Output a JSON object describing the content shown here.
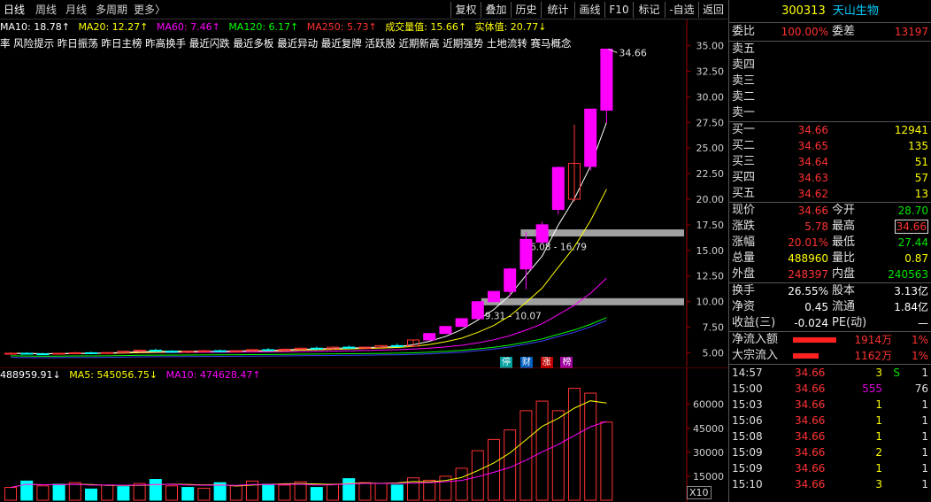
{
  "toolbar": {
    "tabs": [
      "日线",
      "周线",
      "月线",
      "多周期",
      "更多〉"
    ],
    "buttons": [
      "复权",
      "叠加",
      "历史",
      "统计",
      "画线",
      "F10",
      "标记",
      "-自选",
      "返回"
    ]
  },
  "ma": {
    "ma10": "MA10: 18.78↑",
    "ma20": "MA20: 12.27↑",
    "ma60": "MA60: 7.46↑",
    "ma120": "MA120: 6.17↑",
    "ma250": "MA250: 5.73↑",
    "vol": "成交量值: 15.66↑",
    "body": "实体值: 20.77↓"
  },
  "concepts": "率 风险提示 昨日振荡 昨日主榜 昨高换手 最近闪跌 最近多板 最近异动 最近复牌 活跃股 近期新高 近期强势 土地流转 赛马概念",
  "price_axis": [
    "35.00",
    "32.50",
    "30.00",
    "27.50",
    "25.00",
    "22.50",
    "20.00",
    "17.50",
    "15.00",
    "12.50",
    "10.00",
    "7.50",
    "5.00"
  ],
  "price_annotations": {
    "high_label": "34.66",
    "zone1": "16.08 - 16.79",
    "zone2": "9.31 - 10.07"
  },
  "badges": [
    "停",
    "财",
    "涨",
    "榜"
  ],
  "volume_line": {
    "vol": "488959.91↓",
    "ma5": "MA5: 545056.75↓",
    "ma10": "MA10: 474628.47↑"
  },
  "volume_axis": [
    "60000",
    "45000",
    "30000",
    "15000"
  ],
  "x10": "X10",
  "colors": {
    "up": "#ff3232",
    "down": "#00ffff",
    "limit_up": "#ff00ff",
    "ma10": "#ffffff",
    "ma20": "#ffff00",
    "ma60": "#ff00ff",
    "ma120": "#00ff00",
    "ma250": "#4040ff"
  },
  "stock": {
    "code": "300313",
    "name": "天山生物"
  },
  "order": {
    "webi_label": "委比",
    "webi": "100.00%",
    "wecha_label": "委差",
    "wecha": "13197",
    "sells": [
      {
        "label": "卖五",
        "price": "",
        "vol": ""
      },
      {
        "label": "卖四",
        "price": "",
        "vol": ""
      },
      {
        "label": "卖三",
        "price": "",
        "vol": ""
      },
      {
        "label": "卖二",
        "price": "",
        "vol": ""
      },
      {
        "label": "卖一",
        "price": "",
        "vol": ""
      }
    ],
    "buys": [
      {
        "label": "买一",
        "price": "34.66",
        "vol": "12941"
      },
      {
        "label": "买二",
        "price": "34.65",
        "vol": "135"
      },
      {
        "label": "买三",
        "price": "34.64",
        "vol": "51"
      },
      {
        "label": "买四",
        "price": "34.63",
        "vol": "57"
      },
      {
        "label": "买五",
        "price": "34.62",
        "vol": "13"
      }
    ]
  },
  "quote": [
    {
      "l1": "现价",
      "v1": "34.66",
      "c1": "red",
      "l2": "今开",
      "v2": "28.70",
      "c2": "green"
    },
    {
      "l1": "涨跌",
      "v1": "5.78",
      "c1": "red",
      "l2": "最高",
      "v2": "34.66",
      "c2": "red"
    },
    {
      "l1": "涨幅",
      "v1": "20.01%",
      "c1": "red",
      "l2": "最低",
      "v2": "27.44",
      "c2": "green"
    },
    {
      "l1": "总量",
      "v1": "488960",
      "c1": "yellow",
      "l2": "量比",
      "v2": "0.87",
      "c2": "yellow"
    },
    {
      "l1": "外盘",
      "v1": "248397",
      "c1": "red",
      "l2": "内盘",
      "v2": "240563",
      "c2": "green"
    }
  ],
  "fund": [
    {
      "l1": "换手",
      "v1": "26.55%",
      "l2": "股本",
      "v2": "3.13亿"
    },
    {
      "l1": "净资",
      "v1": "0.45",
      "l2": "流通",
      "v2": "1.84亿"
    },
    {
      "l1": "收益(三)",
      "v1": "-0.024",
      "l2": "PE(动)",
      "v2": "—"
    }
  ],
  "flow": [
    {
      "label": "净流入额",
      "value": "1914万",
      "pct": "1%",
      "bar": 0.7
    },
    {
      "label": "大宗流入",
      "value": "1162万",
      "pct": "1%",
      "bar": 0.42
    }
  ],
  "ticks": [
    {
      "time": "14:57",
      "price": "34.66",
      "vol": "3",
      "vcolor": "yellow",
      "flag": "S",
      "num": "1"
    },
    {
      "time": "15:00",
      "price": "34.66",
      "vol": "555",
      "vcolor": "magenta",
      "flag": "",
      "num": "76"
    },
    {
      "time": "15:03",
      "price": "34.66",
      "vol": "1",
      "vcolor": "yellow",
      "flag": "",
      "num": "1"
    },
    {
      "time": "15:06",
      "price": "34.66",
      "vol": "1",
      "vcolor": "yellow",
      "flag": "",
      "num": "1"
    },
    {
      "time": "15:08",
      "price": "34.66",
      "vol": "1",
      "vcolor": "yellow",
      "flag": "",
      "num": "1"
    },
    {
      "time": "15:09",
      "price": "34.66",
      "vol": "2",
      "vcolor": "yellow",
      "flag": "",
      "num": "1"
    },
    {
      "time": "15:09",
      "price": "34.66",
      "vol": "1",
      "vcolor": "yellow",
      "flag": "",
      "num": "1"
    },
    {
      "time": "15:10",
      "price": "34.66",
      "vol": "3",
      "vcolor": "yellow",
      "flag": "",
      "num": "1"
    }
  ],
  "chart_data": {
    "type": "candlestick",
    "ylim": [
      4.0,
      36.0
    ],
    "candles": [
      {
        "o": 4.9,
        "h": 5.05,
        "l": 4.85,
        "c": 4.95,
        "up": true
      },
      {
        "o": 4.95,
        "h": 5.05,
        "l": 4.85,
        "c": 4.9,
        "up": false
      },
      {
        "o": 4.9,
        "h": 5.0,
        "l": 4.82,
        "c": 4.88,
        "up": false
      },
      {
        "o": 4.88,
        "h": 5.0,
        "l": 4.8,
        "c": 4.95,
        "up": true
      },
      {
        "o": 4.95,
        "h": 5.1,
        "l": 4.9,
        "c": 5.0,
        "up": true
      },
      {
        "o": 5.0,
        "h": 5.1,
        "l": 4.9,
        "c": 4.95,
        "up": false
      },
      {
        "o": 4.95,
        "h": 5.05,
        "l": 4.85,
        "c": 5.02,
        "up": true
      },
      {
        "o": 5.02,
        "h": 5.2,
        "l": 4.95,
        "c": 5.15,
        "up": true
      },
      {
        "o": 5.15,
        "h": 5.3,
        "l": 5.05,
        "c": 5.25,
        "up": true
      },
      {
        "o": 5.25,
        "h": 5.4,
        "l": 5.1,
        "c": 5.15,
        "up": false
      },
      {
        "o": 5.15,
        "h": 5.25,
        "l": 5.0,
        "c": 5.05,
        "up": false
      },
      {
        "o": 5.05,
        "h": 5.2,
        "l": 4.95,
        "c": 5.15,
        "up": true
      },
      {
        "o": 5.15,
        "h": 5.3,
        "l": 5.05,
        "c": 5.2,
        "up": true
      },
      {
        "o": 5.2,
        "h": 5.3,
        "l": 5.05,
        "c": 5.1,
        "up": false
      },
      {
        "o": 5.1,
        "h": 5.25,
        "l": 5.0,
        "c": 5.2,
        "up": true
      },
      {
        "o": 5.2,
        "h": 5.35,
        "l": 5.1,
        "c": 5.3,
        "up": true
      },
      {
        "o": 5.3,
        "h": 5.45,
        "l": 5.2,
        "c": 5.25,
        "up": false
      },
      {
        "o": 5.25,
        "h": 5.4,
        "l": 5.1,
        "c": 5.35,
        "up": true
      },
      {
        "o": 5.35,
        "h": 5.5,
        "l": 5.25,
        "c": 5.45,
        "up": true
      },
      {
        "o": 5.45,
        "h": 5.6,
        "l": 5.3,
        "c": 5.4,
        "up": false
      },
      {
        "o": 5.4,
        "h": 5.6,
        "l": 5.3,
        "c": 5.55,
        "up": true
      },
      {
        "o": 5.55,
        "h": 5.7,
        "l": 5.4,
        "c": 5.45,
        "up": false
      },
      {
        "o": 5.45,
        "h": 5.6,
        "l": 5.35,
        "c": 5.55,
        "up": true
      },
      {
        "o": 5.55,
        "h": 5.75,
        "l": 5.45,
        "c": 5.7,
        "up": true
      },
      {
        "o": 5.7,
        "h": 5.9,
        "l": 5.6,
        "c": 5.65,
        "up": false
      },
      {
        "o": 5.65,
        "h": 6.3,
        "l": 5.6,
        "c": 6.25,
        "up": true
      },
      {
        "o": 6.25,
        "h": 6.9,
        "l": 6.2,
        "c": 6.88,
        "up": true,
        "limit": true
      },
      {
        "o": 6.88,
        "h": 7.6,
        "l": 6.85,
        "c": 7.57,
        "up": true,
        "limit": true
      },
      {
        "o": 7.57,
        "h": 8.35,
        "l": 7.55,
        "c": 8.33,
        "up": true,
        "limit": true
      },
      {
        "o": 8.33,
        "h": 10.07,
        "l": 8.3,
        "c": 9.99,
        "up": true,
        "limit": true
      },
      {
        "o": 9.99,
        "h": 11.0,
        "l": 9.9,
        "c": 10.99,
        "up": true,
        "limit": true
      },
      {
        "o": 10.99,
        "h": 13.3,
        "l": 10.5,
        "c": 13.19,
        "up": true,
        "limit": true
      },
      {
        "o": 13.19,
        "h": 16.79,
        "l": 11.2,
        "c": 16.08,
        "up": true,
        "limit": true
      },
      {
        "o": 15.8,
        "h": 17.8,
        "l": 15.6,
        "c": 17.5,
        "up": true,
        "limit": true
      },
      {
        "o": 19.0,
        "h": 23.2,
        "l": 18.5,
        "c": 23.1,
        "up": true,
        "limit": true
      },
      {
        "o": 20.0,
        "h": 27.3,
        "l": 19.8,
        "c": 23.5,
        "up": true
      },
      {
        "o": 23.2,
        "h": 28.8,
        "l": 22.8,
        "c": 28.8,
        "up": true,
        "limit": true
      },
      {
        "o": 28.7,
        "h": 34.66,
        "l": 27.44,
        "c": 34.66,
        "up": true,
        "limit": true
      }
    ],
    "volumes": [
      {
        "v": 8000,
        "up": true
      },
      {
        "v": 12000,
        "up": false
      },
      {
        "v": 9000,
        "up": true
      },
      {
        "v": 10000,
        "up": false
      },
      {
        "v": 11000,
        "up": true
      },
      {
        "v": 7000,
        "up": false
      },
      {
        "v": 9500,
        "up": true
      },
      {
        "v": 8500,
        "up": false
      },
      {
        "v": 10500,
        "up": true
      },
      {
        "v": 13000,
        "up": false
      },
      {
        "v": 9000,
        "up": true
      },
      {
        "v": 8000,
        "up": false
      },
      {
        "v": 7500,
        "up": true
      },
      {
        "v": 11000,
        "up": false
      },
      {
        "v": 9000,
        "up": true
      },
      {
        "v": 12000,
        "up": true
      },
      {
        "v": 10000,
        "up": false
      },
      {
        "v": 9500,
        "up": true
      },
      {
        "v": 11500,
        "up": true
      },
      {
        "v": 8000,
        "up": false
      },
      {
        "v": 10000,
        "up": true
      },
      {
        "v": 13500,
        "up": false
      },
      {
        "v": 11000,
        "up": true
      },
      {
        "v": 10500,
        "up": true
      },
      {
        "v": 9500,
        "up": false
      },
      {
        "v": 14000,
        "up": true
      },
      {
        "v": 12500,
        "up": true
      },
      {
        "v": 15000,
        "up": true
      },
      {
        "v": 20000,
        "up": true
      },
      {
        "v": 31000,
        "up": true
      },
      {
        "v": 38000,
        "up": true
      },
      {
        "v": 44000,
        "up": true
      },
      {
        "v": 56000,
        "up": true
      },
      {
        "v": 62000,
        "up": true
      },
      {
        "v": 56000,
        "up": true
      },
      {
        "v": 70000,
        "up": true
      },
      {
        "v": 67000,
        "up": true
      },
      {
        "v": 48895,
        "up": true
      }
    ],
    "vol_ylim": [
      0,
      72000
    ]
  }
}
